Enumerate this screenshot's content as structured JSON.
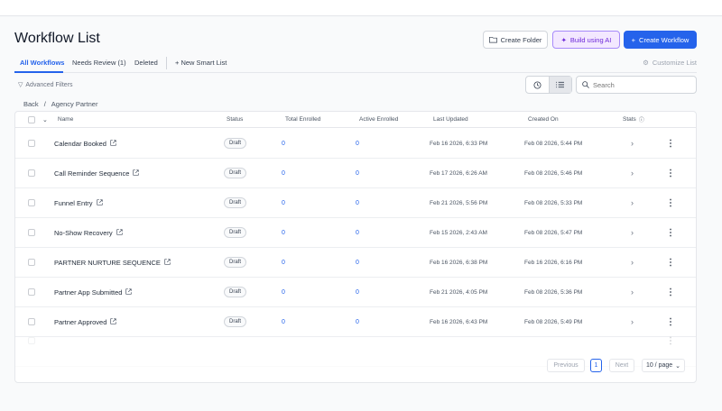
{
  "page": {
    "title": "Workflow List",
    "actions": {
      "create_folder": "Create Folder",
      "build_ai": "Build using AI",
      "create_workflow": "Create Workflow"
    },
    "tabs": [
      "All Workflows",
      "Needs Review (1)",
      "Deleted"
    ],
    "new_smart_list": "New Smart List",
    "customize_list": "Customize List",
    "advanced_filters": "Advanced Filters",
    "search_placeholder": "Search",
    "breadcrumb": {
      "back": "Back",
      "sep": "/",
      "current": "Agency Partner"
    }
  },
  "table": {
    "columns": {
      "name": "Name",
      "status": "Status",
      "total_enrolled": "Total Enrolled",
      "active_enrolled": "Active Enrolled",
      "last_updated": "Last Updated",
      "created_on": "Created On",
      "stats": "Stats"
    },
    "rows": [
      {
        "name": "Calendar Booked",
        "status": "Draft",
        "total": "0",
        "active": "0",
        "updated": "Feb 16 2026, 6:33 PM",
        "created": "Feb 08 2026, 5:44 PM"
      },
      {
        "name": "Call Reminder Sequence",
        "status": "Draft",
        "total": "0",
        "active": "0",
        "updated": "Feb 17 2026, 6:26 AM",
        "created": "Feb 08 2026, 5:46 PM"
      },
      {
        "name": "Funnel Entry",
        "status": "Draft",
        "total": "0",
        "active": "0",
        "updated": "Feb 21 2026, 5:56 PM",
        "created": "Feb 08 2026, 5:33 PM"
      },
      {
        "name": "No-Show Recovery",
        "status": "Draft",
        "total": "0",
        "active": "0",
        "updated": "Feb 15 2026, 2:43 AM",
        "created": "Feb 08 2026, 5:47 PM"
      },
      {
        "name": "PARTNER NURTURE SEQUENCE",
        "status": "Draft",
        "total": "0",
        "active": "0",
        "updated": "Feb 16 2026, 6:38 PM",
        "created": "Feb 16 2026, 6:16 PM"
      },
      {
        "name": "Partner App Submitted",
        "status": "Draft",
        "total": "0",
        "active": "0",
        "updated": "Feb 21 2026, 4:05 PM",
        "created": "Feb 08 2026, 5:36 PM"
      },
      {
        "name": "Partner Approved",
        "status": "Draft",
        "total": "0",
        "active": "0",
        "updated": "Feb 16 2026, 6:43 PM",
        "created": "Feb 08 2026, 5:49 PM"
      }
    ]
  },
  "pagination": {
    "previous": "Previous",
    "current": "1",
    "next": "Next",
    "page_size": "10 / page"
  },
  "colors": {
    "primary": "#2563eb",
    "ai_purple": "#6d28d9",
    "ai_bg": "#f3e8ff"
  },
  "icons": [
    "folder-icon",
    "sparkle-icon",
    "plus-icon",
    "settings-icon",
    "filter-icon",
    "clock-icon",
    "list-icon",
    "search-icon",
    "external-link-icon",
    "chevron-right-icon",
    "kebab-icon",
    "chevron-down-icon",
    "info-icon"
  ]
}
